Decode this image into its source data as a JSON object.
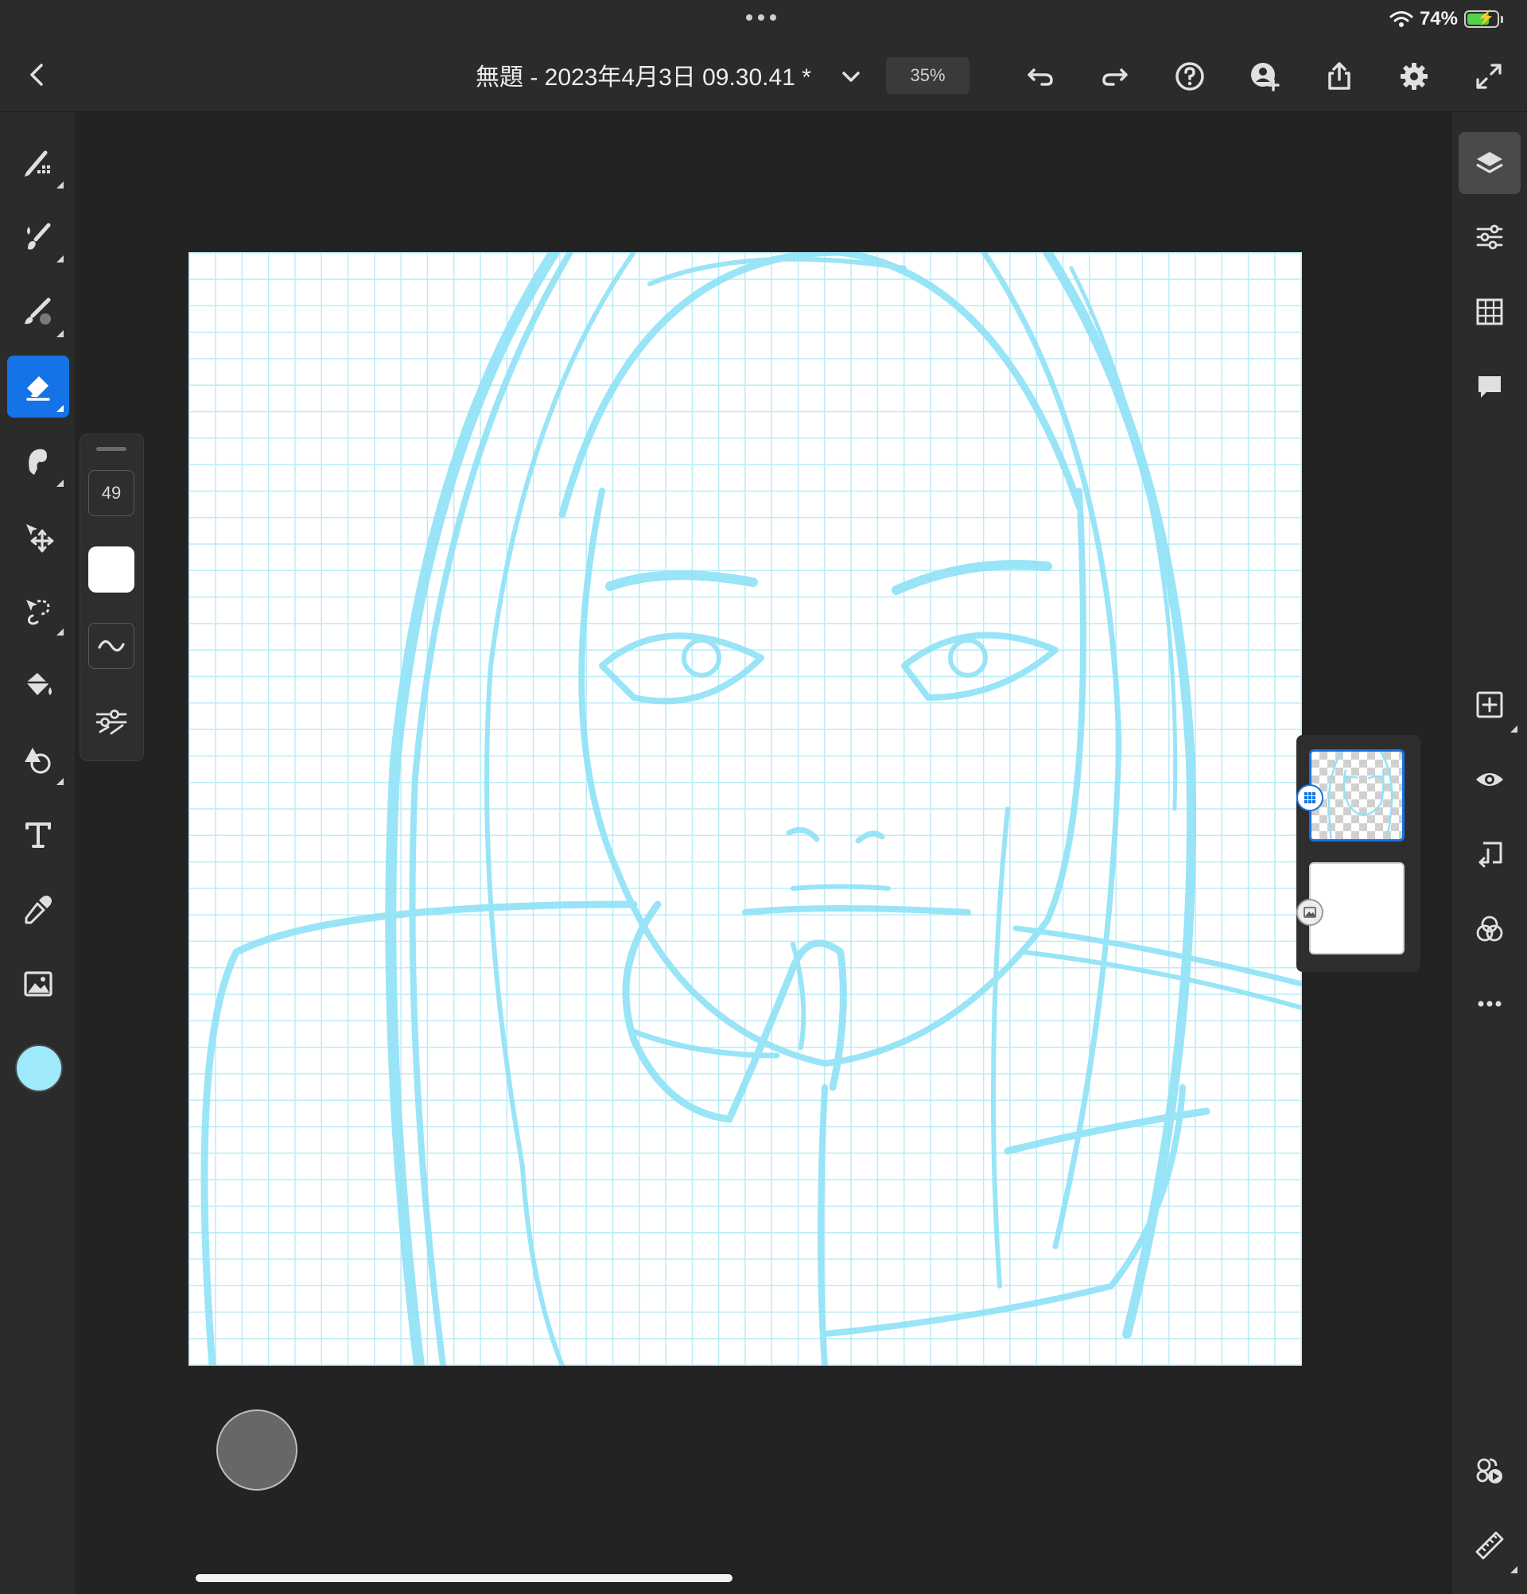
{
  "status_bar": {
    "battery_percent": "74%",
    "battery_level": 0.74
  },
  "header": {
    "back_icon": "chevron-left-icon",
    "document_title": "無題 - 2023年4月3日 09.30.41 *",
    "zoom": "35%",
    "actions": [
      "undo-icon",
      "redo-icon",
      "help-icon",
      "invite-icon",
      "share-icon",
      "settings-icon",
      "fullscreen-icon"
    ]
  },
  "tools": [
    {
      "name": "pixel-brush",
      "icon": "pixel-brush-icon"
    },
    {
      "name": "live-brush",
      "icon": "live-brush-icon"
    },
    {
      "name": "vector-brush",
      "icon": "vector-brush-icon"
    },
    {
      "name": "eraser",
      "icon": "eraser-icon",
      "active": true
    },
    {
      "name": "smudge",
      "icon": "smudge-icon"
    },
    {
      "name": "transform",
      "icon": "transform-icon"
    },
    {
      "name": "selection",
      "icon": "lasso-icon"
    },
    {
      "name": "fill",
      "icon": "fill-bucket-icon"
    },
    {
      "name": "shapes",
      "icon": "shapes-icon"
    },
    {
      "name": "text",
      "icon": "text-icon"
    },
    {
      "name": "eyedropper",
      "icon": "eyedropper-icon"
    },
    {
      "name": "image",
      "icon": "image-icon"
    }
  ],
  "brush_panel": {
    "size": "49",
    "smoothing_icon": "wave-icon",
    "settings_icon": "sliders-icon"
  },
  "colors": {
    "current_color": "#9ee9fb",
    "accent": "#1473e6",
    "sketch": "#8fe2f7"
  },
  "right_panel": [
    "layers-icon",
    "properties-icon",
    "grid-icon",
    "comments-icon",
    "add-layer-icon",
    "visibility-icon",
    "merge-down-icon",
    "blend-icon",
    "more-icon",
    "adjustments-icon",
    "ruler-icon"
  ],
  "layers": [
    {
      "name": "sketch-layer",
      "type": "pixel",
      "selected": true
    },
    {
      "name": "background-layer",
      "type": "image",
      "selected": false
    }
  ]
}
